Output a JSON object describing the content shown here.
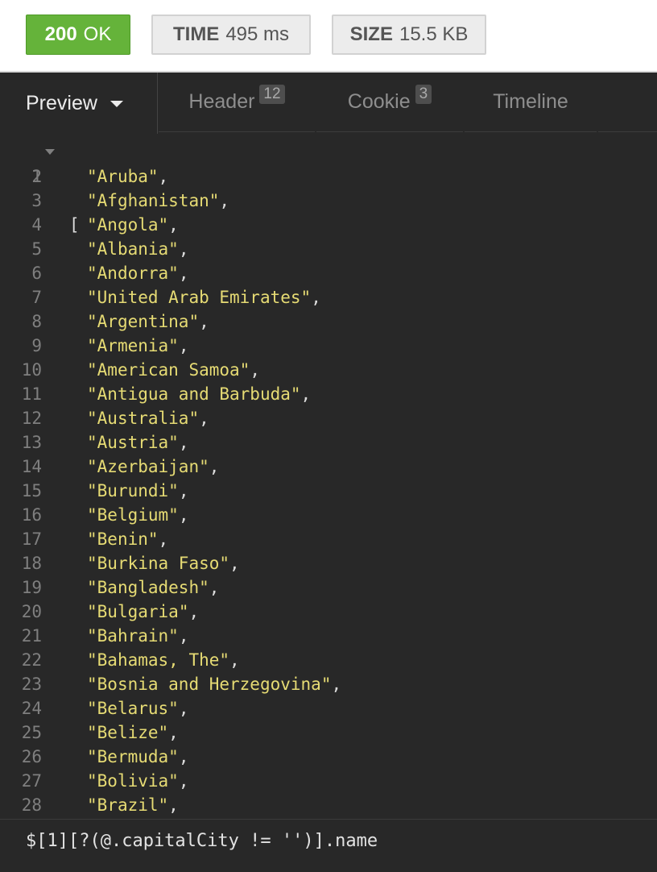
{
  "status": {
    "code": "200",
    "text": "OK",
    "time_label": "TIME",
    "time_value": "495 ms",
    "size_label": "SIZE",
    "size_value": "15.5 KB",
    "colors": {
      "success": "#65b33a",
      "pill_gray": "#ececec"
    }
  },
  "tabs": [
    {
      "label": "Preview",
      "active": true,
      "icon": "caret-down-icon"
    },
    {
      "label": "Header",
      "badge": "12"
    },
    {
      "label": "Cookie",
      "badge": "3"
    },
    {
      "label": "Timeline"
    }
  ],
  "code": {
    "open_bracket": "[",
    "items": [
      "Aruba",
      "Afghanistan",
      "Angola",
      "Albania",
      "Andorra",
      "United Arab Emirates",
      "Argentina",
      "Armenia",
      "American Samoa",
      "Antigua and Barbuda",
      "Australia",
      "Austria",
      "Azerbaijan",
      "Burundi",
      "Belgium",
      "Benin",
      "Burkina Faso",
      "Bangladesh",
      "Bulgaria",
      "Bahrain",
      "Bahamas, The",
      "Bosnia and Herzegovina",
      "Belarus",
      "Belize",
      "Bermuda",
      "Bolivia",
      "Brazil"
    ],
    "colors": {
      "string": "#e6db74",
      "line_number": "#7f7f7f",
      "background": "#282828"
    }
  },
  "filter": {
    "value": "$[1][?(@.capitalCity != '')].name"
  }
}
